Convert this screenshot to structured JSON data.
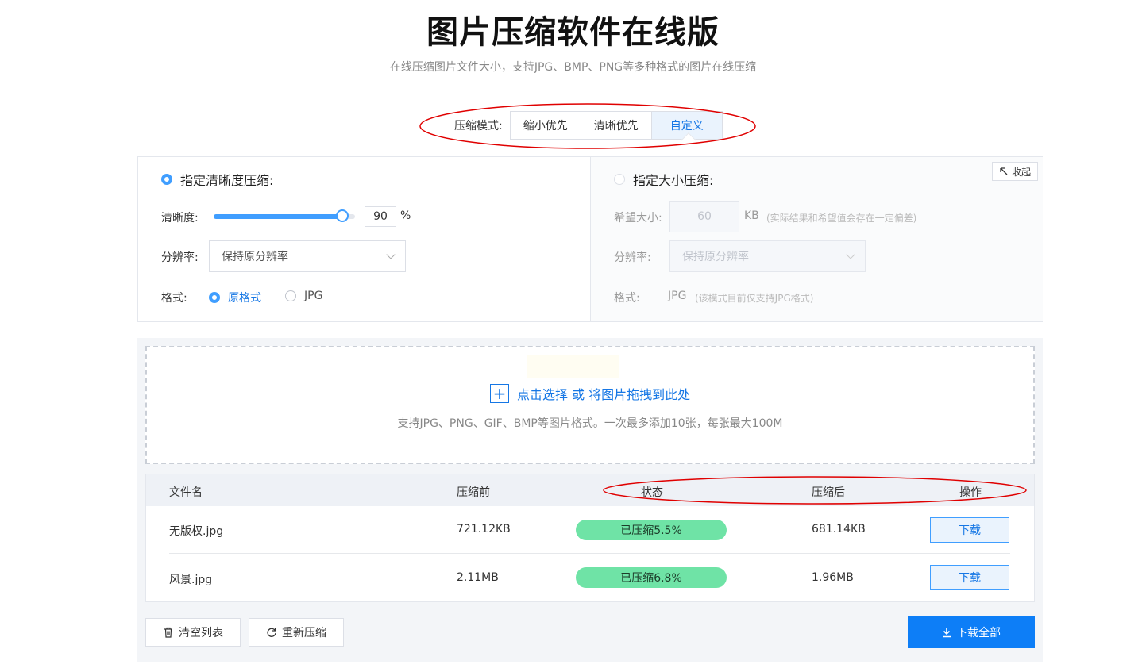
{
  "header": {
    "title": "图片压缩软件在线版",
    "subtitle": "在线压缩图片文件大小，支持JPG、BMP、PNG等多种格式的图片在线压缩"
  },
  "mode": {
    "label": "压缩模式:",
    "options": [
      "缩小优先",
      "清晰优先",
      "自定义"
    ],
    "selected": "自定义"
  },
  "collapse_label": "收起",
  "quality_section": {
    "title": "指定清晰度压缩:",
    "selected": true,
    "clarity_label": "清晰度:",
    "clarity_value": "90",
    "clarity_unit": "%",
    "resolution_label": "分辨率:",
    "resolution_value": "保持原分辨率",
    "format_label": "格式:",
    "format_options": [
      "原格式",
      "JPG"
    ],
    "format_selected": "原格式"
  },
  "size_section": {
    "title": "指定大小压缩:",
    "selected": false,
    "size_label": "希望大小:",
    "size_value": "60",
    "size_unit": "KB",
    "size_note": "(实际结果和希望值会存在一定偏差)",
    "resolution_label": "分辨率:",
    "resolution_value": "保持原分辨率",
    "format_label": "格式:",
    "format_value": "JPG",
    "format_note": "(该模式目前仅支持JPG格式)"
  },
  "upload": {
    "main_text": "点击选择 或 将图片拖拽到此处",
    "sub_text": "支持JPG、PNG、GIF、BMP等图片格式。一次最多添加10张，每张最大100M"
  },
  "table": {
    "headers": [
      "文件名",
      "压缩前",
      "状态",
      "压缩后",
      "操作"
    ],
    "rows": [
      {
        "name": "无版权.jpg",
        "before": "721.12KB",
        "status": "已压缩5.5%",
        "after": "681.14KB",
        "action": "下载"
      },
      {
        "name": "风景.jpg",
        "before": "2.11MB",
        "status": "已压缩6.8%",
        "after": "1.96MB",
        "action": "下载"
      }
    ]
  },
  "footer": {
    "clear_label": "清空列表",
    "recompress_label": "重新压缩",
    "download_all_label": "下载全部"
  },
  "colors": {
    "accent": "#409eff",
    "primary_button": "#0d7ef7",
    "status_pill": "#6fe3a6",
    "annotation": "#e00000"
  }
}
